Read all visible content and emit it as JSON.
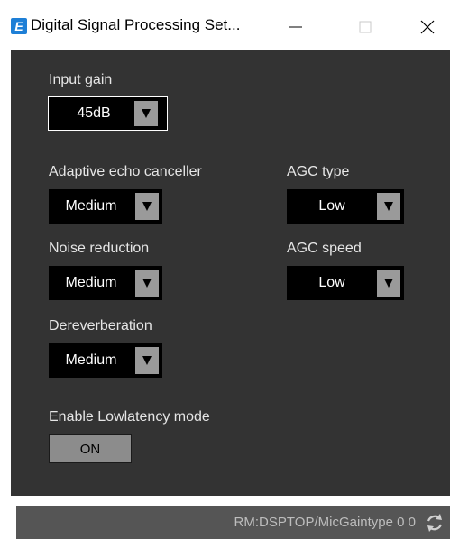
{
  "window": {
    "title": "Digital Signal Processing Set...",
    "icon": "app-logo-icon",
    "app_icon_letter": "E",
    "controls": [
      "minimize-icon",
      "maximize-icon",
      "close-icon"
    ]
  },
  "settings": {
    "input_gain": {
      "label": "Input gain",
      "value": "45dB"
    },
    "adaptive_echo_canceller": {
      "label": "Adaptive echo canceller",
      "value": "Medium"
    },
    "noise_reduction": {
      "label": "Noise reduction",
      "value": "Medium"
    },
    "dereverberation": {
      "label": "Dereverberation",
      "value": "Medium"
    },
    "agc_type": {
      "label": "AGC type",
      "value": "Low"
    },
    "agc_speed": {
      "label": "AGC speed",
      "value": "Low"
    },
    "lowlatency": {
      "label": "Enable Lowlatency mode",
      "button": "ON"
    }
  },
  "statusbar": {
    "text": "RM:DSPTOP/MicGaintype 0 0",
    "icon": "refresh-icon"
  },
  "colors": {
    "panel_bg": "#333333",
    "dropdown_bg": "#000000",
    "arrow_box": "#9a9a9a",
    "status_bg": "#555555",
    "accent": "#1e7fd6"
  }
}
